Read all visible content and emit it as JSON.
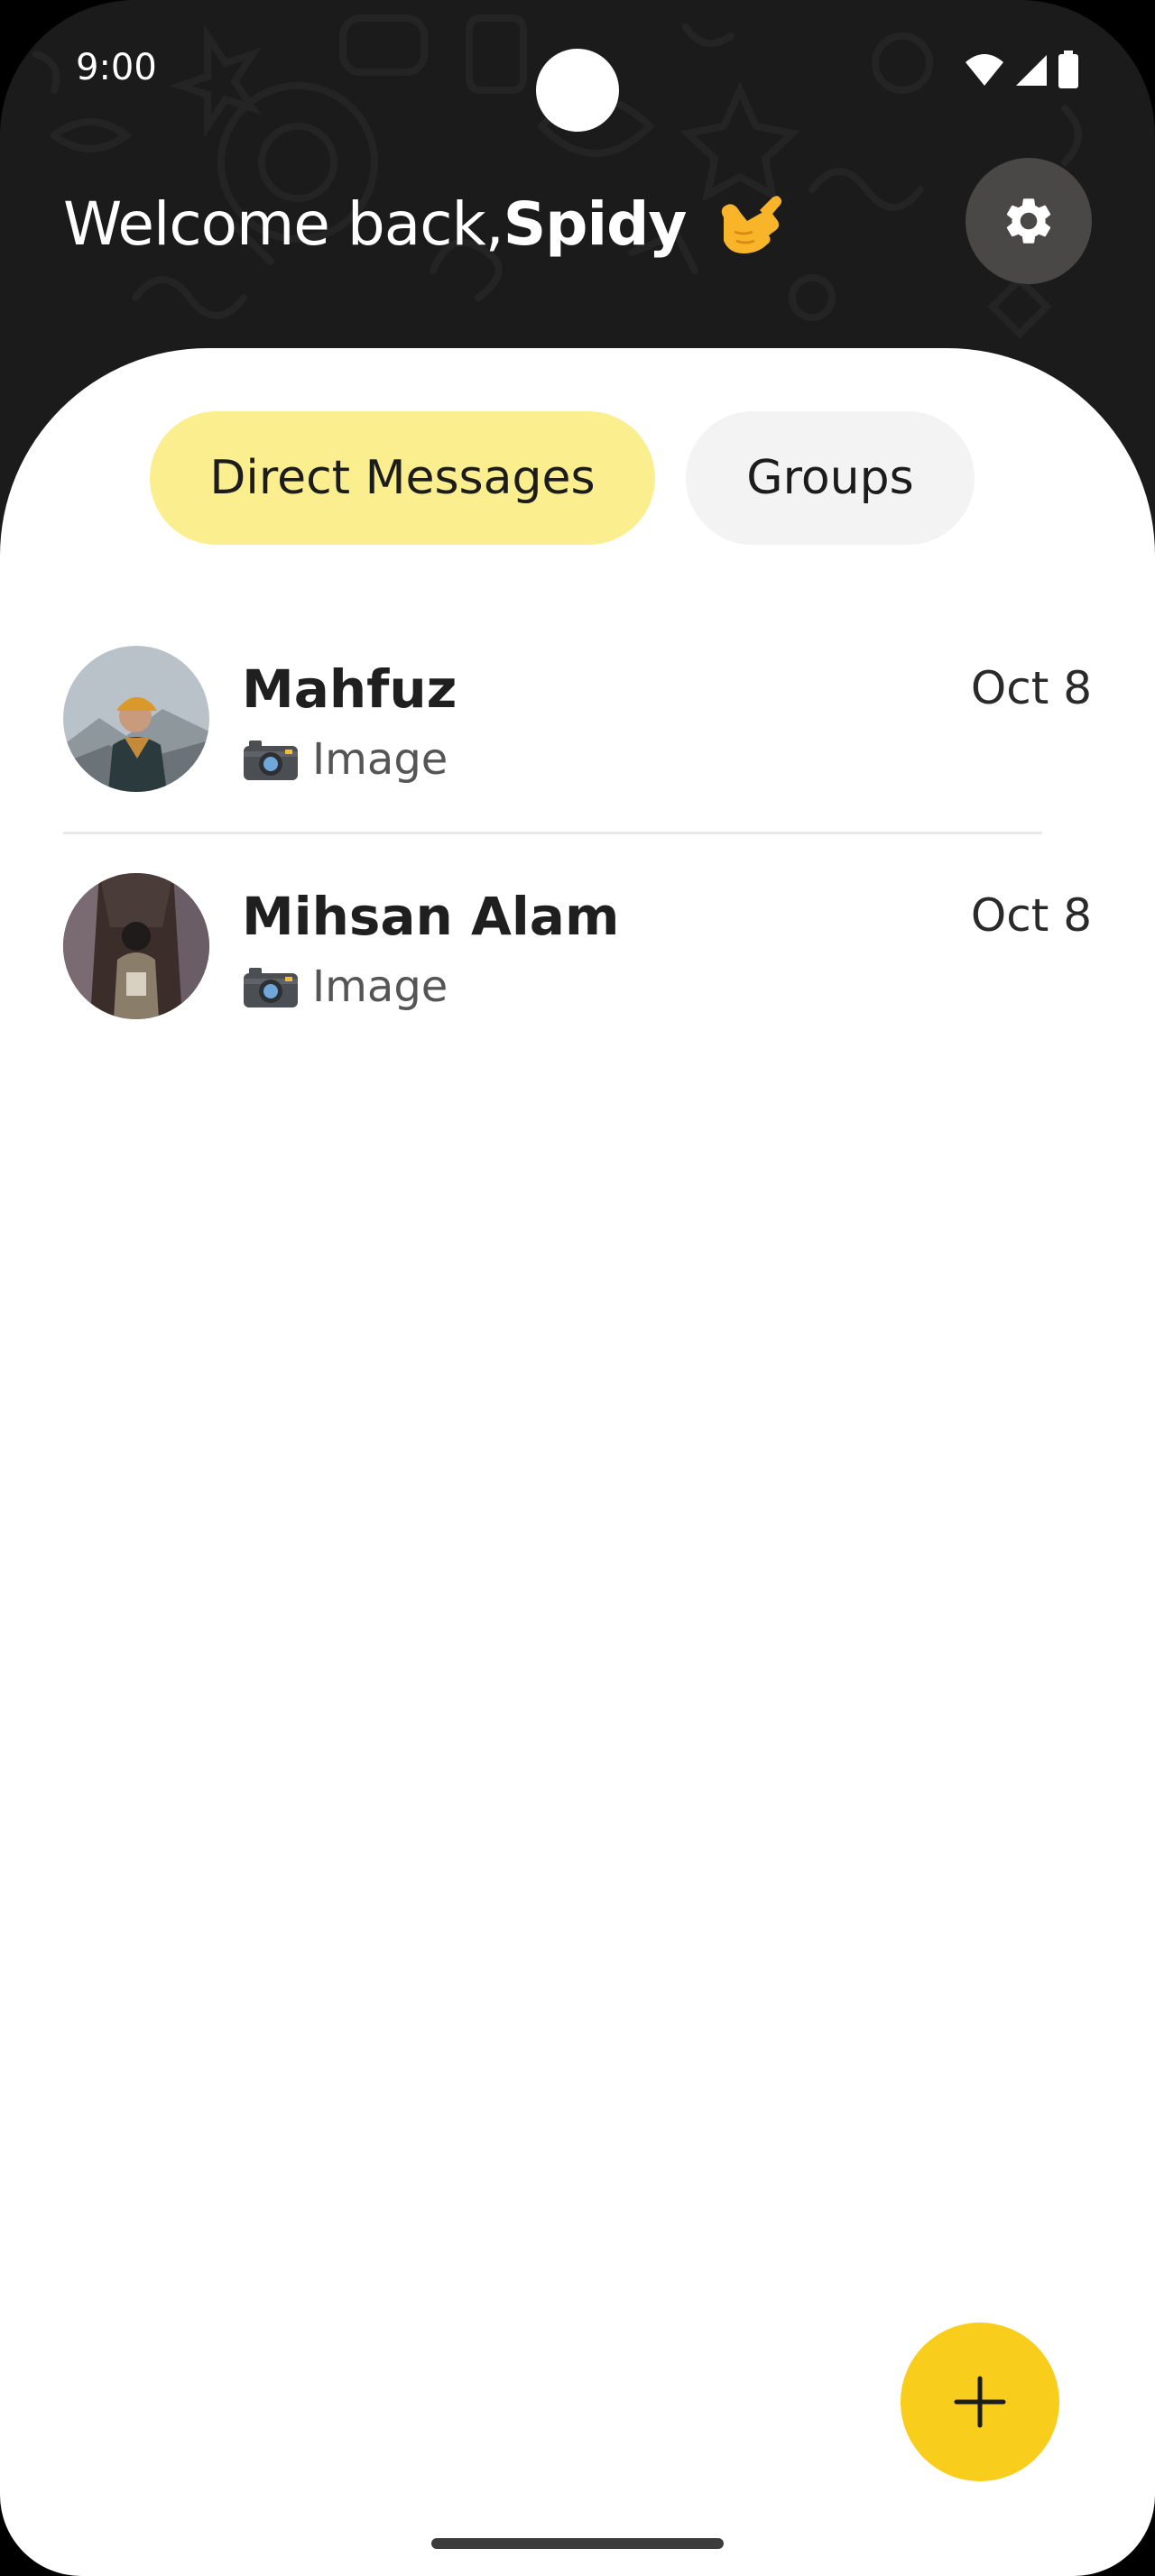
{
  "status_bar": {
    "time": "9:00",
    "icons": [
      "wifi-icon",
      "cellular-signal-icon",
      "battery-icon"
    ]
  },
  "header": {
    "greeting_prefix": "Welcome back,",
    "user_name": "Spidy",
    "emoji_icon": "call-me-hand-emoji",
    "settings_icon": "gear-icon"
  },
  "tabs": [
    {
      "label": "Direct Messages",
      "selected": true
    },
    {
      "label": "Groups",
      "selected": false
    }
  ],
  "chats": [
    {
      "name": "Mahfuz",
      "date": "Oct 8",
      "preview_icon": "camera-icon",
      "preview_text": "Image"
    },
    {
      "name": "Mihsan Alam",
      "date": "Oct 8",
      "preview_icon": "camera-icon",
      "preview_text": "Image"
    }
  ],
  "fab": {
    "icon": "plus-icon"
  },
  "colors": {
    "header_bg": "#1b1b1b",
    "tab_selected_bg": "#fbee8e",
    "tab_unselected_bg": "#f3f3f3",
    "fab_bg": "#f8cd1c",
    "settings_bg": "#4a4846"
  }
}
